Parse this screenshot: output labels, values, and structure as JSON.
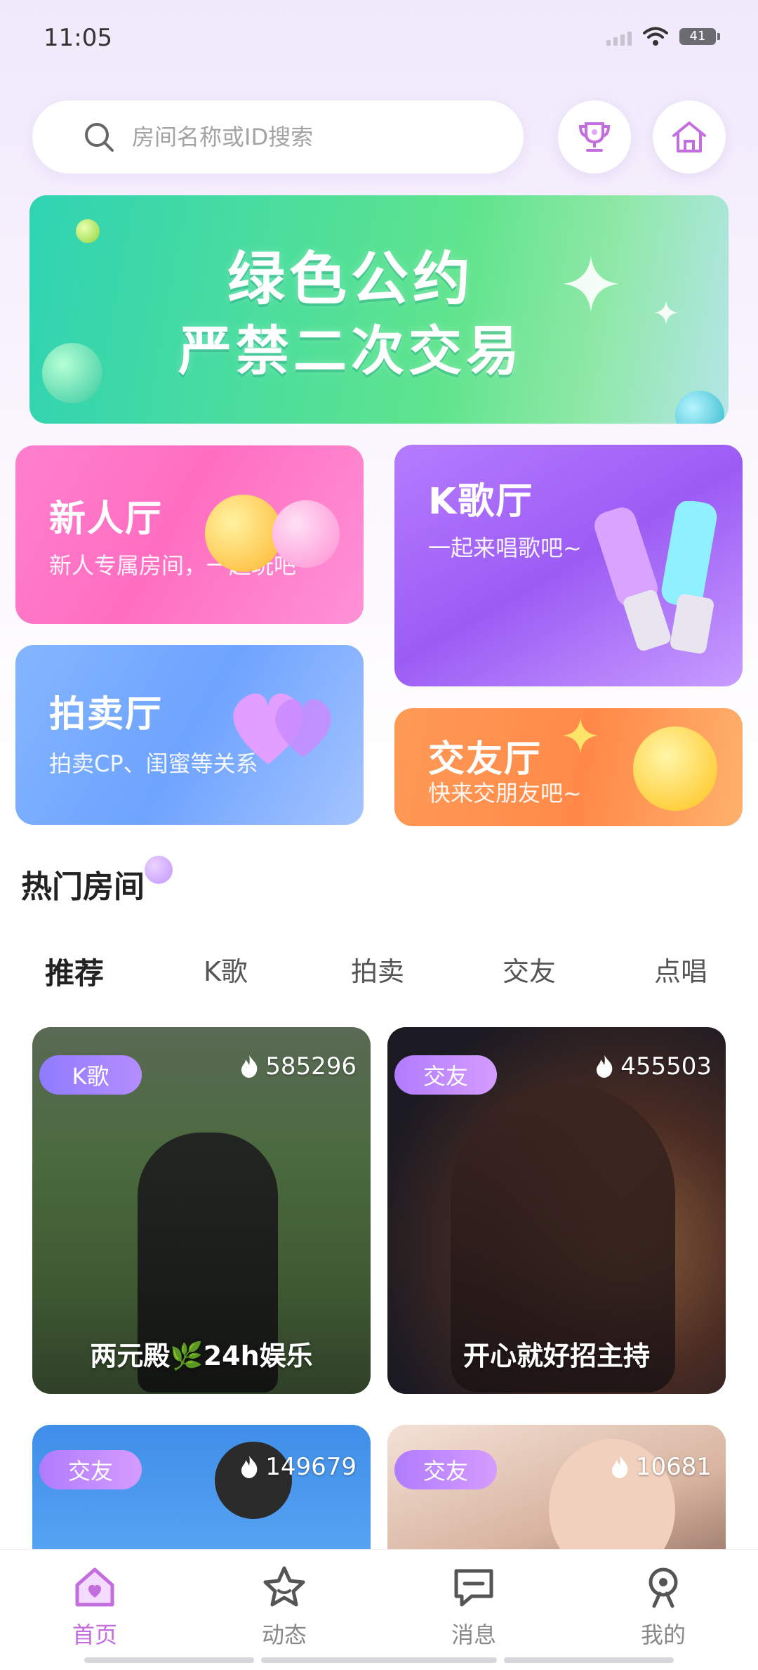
{
  "status": {
    "time": "11:05",
    "battery": "41"
  },
  "search": {
    "placeholder": "房间名称或ID搜索"
  },
  "banner": {
    "line1": "绿色公约",
    "line2": "严禁二次交易"
  },
  "categories": [
    {
      "title": "新人厅",
      "subtitle": "新人专属房间，一起玩吧"
    },
    {
      "title": "K歌厅",
      "subtitle": "一起来唱歌吧~"
    },
    {
      "title": "拍卖厅",
      "subtitle": "拍卖CP、闺蜜等关系"
    },
    {
      "title": "交友厅",
      "subtitle": "快来交朋友吧~"
    }
  ],
  "hot": {
    "title": "热门房间",
    "tabs": [
      "推荐",
      "K歌",
      "拍卖",
      "交友",
      "点唱"
    ],
    "rooms": [
      {
        "tag": "K歌",
        "heat": "585296",
        "name": "两元殿🌿24h娱乐"
      },
      {
        "tag": "交友",
        "heat": "455503",
        "name": "开心就好招主持"
      },
      {
        "tag": "交友",
        "heat": "149679",
        "name": ""
      },
      {
        "tag": "交友",
        "heat": "10681",
        "name": ""
      }
    ]
  },
  "nav": [
    "首页",
    "动态",
    "消息",
    "我的"
  ],
  "colors": {
    "accent": "#c46dde",
    "banner_green": "#48dca0",
    "tag_purple": "#a27bff"
  },
  "icons": [
    "search-icon",
    "trophy-icon",
    "house-icon",
    "flame-icon",
    "home-nav-icon",
    "star-nav-icon",
    "message-nav-icon",
    "profile-nav-icon"
  ]
}
